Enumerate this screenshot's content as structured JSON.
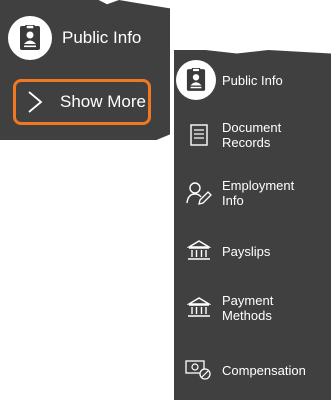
{
  "menu_collapsed": {
    "public_info_label": "Public Info",
    "show_more_label": "Show More",
    "highlight_color": "#f07820"
  },
  "menu_expanded": {
    "items": [
      {
        "label": "Public Info",
        "icon": "id-badge-icon"
      },
      {
        "label": "Document\nRecords",
        "icon": "document-icon"
      },
      {
        "label": "Employment\nInfo",
        "icon": "employee-edit-icon"
      },
      {
        "label": "Payslips",
        "icon": "bank-icon"
      },
      {
        "label": "Payment\nMethods",
        "icon": "bank-icon"
      },
      {
        "label": "Compensation",
        "icon": "money-coins-icon"
      }
    ]
  },
  "colors": {
    "menu_background": "#404040",
    "text": "#ffffff"
  }
}
